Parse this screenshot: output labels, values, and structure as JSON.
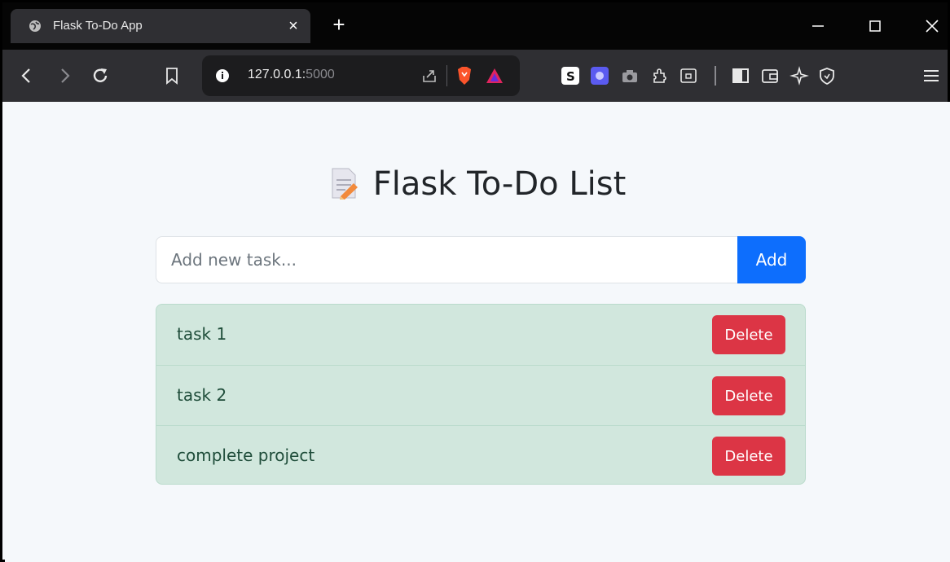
{
  "browser": {
    "tab_title": "Flask To-Do App",
    "tab_close": "×",
    "new_tab": "+",
    "url_host": "127.0.0.1:",
    "url_port": "5000"
  },
  "page": {
    "title": "Flask To-Do List",
    "input_placeholder": "Add new task...",
    "add_label": "Add",
    "tasks": [
      {
        "text": "task 1",
        "delete_label": "Delete"
      },
      {
        "text": "task 2",
        "delete_label": "Delete"
      },
      {
        "text": "complete project",
        "delete_label": "Delete"
      }
    ]
  },
  "colors": {
    "add_button": "#0d6efd",
    "delete_button": "#dc3545",
    "list_background": "#d1e7dd"
  },
  "icons": [
    "globe-icon",
    "close-icon",
    "plus-icon",
    "minimize-icon",
    "maximize-icon",
    "window-close-icon",
    "back-icon",
    "forward-icon",
    "reload-icon",
    "bookmark-icon",
    "info-icon",
    "share-icon",
    "brave-shield-icon",
    "brave-rewards-icon",
    "extension-s-icon",
    "extension-purple-icon",
    "camera-icon",
    "puzzle-icon",
    "reader-icon",
    "sidebar-icon",
    "wallet-icon",
    "leo-icon",
    "vpn-icon",
    "menu-icon",
    "memo-icon"
  ]
}
